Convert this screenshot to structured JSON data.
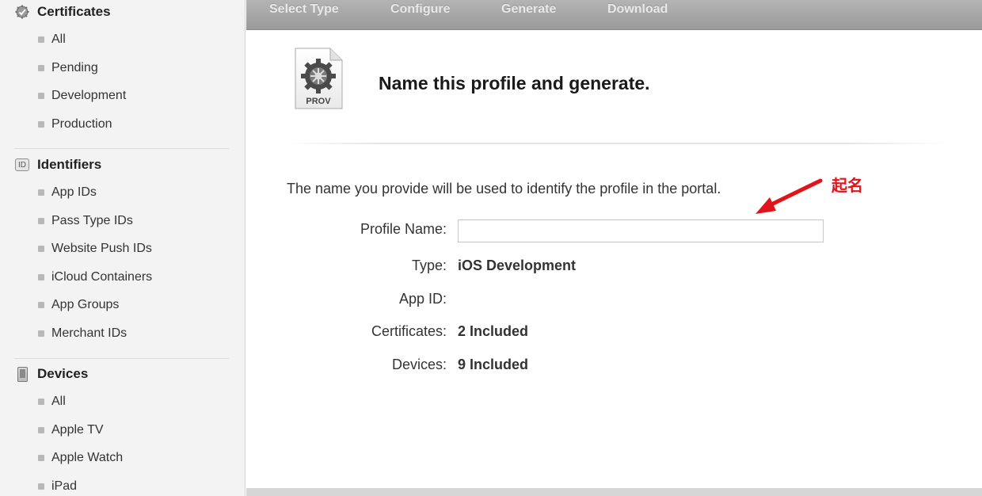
{
  "sidebar": {
    "certificates": {
      "title": "Certificates",
      "icon": "certificate-gear-icon",
      "items": [
        "All",
        "Pending",
        "Development",
        "Production"
      ]
    },
    "identifiers": {
      "title": "Identifiers",
      "icon": "id-badge-icon",
      "badge_text": "ID",
      "items": [
        "App IDs",
        "Pass Type IDs",
        "Website Push IDs",
        "iCloud Containers",
        "App Groups",
        "Merchant IDs"
      ]
    },
    "devices": {
      "title": "Devices",
      "icon": "iphone-icon",
      "items": [
        "All",
        "Apple TV",
        "Apple Watch",
        "iPad"
      ]
    }
  },
  "steps": [
    "Select Type",
    "Configure",
    "Generate",
    "Download"
  ],
  "main": {
    "icon_label": "PROV",
    "title": "Name this profile and generate.",
    "intro": "The name you provide will be used to identify the profile in the portal.",
    "form": {
      "profile_name_label": "Profile Name:",
      "profile_name_value": "",
      "type_label": "Type:",
      "type_value": "iOS Development",
      "app_id_label": "App ID:",
      "app_id_value": "",
      "certificates_label": "Certificates:",
      "certificates_value": "2 Included",
      "devices_label": "Devices:",
      "devices_value": "9 Included"
    }
  },
  "annotation": {
    "text": "起名",
    "color": "#e0141a"
  }
}
